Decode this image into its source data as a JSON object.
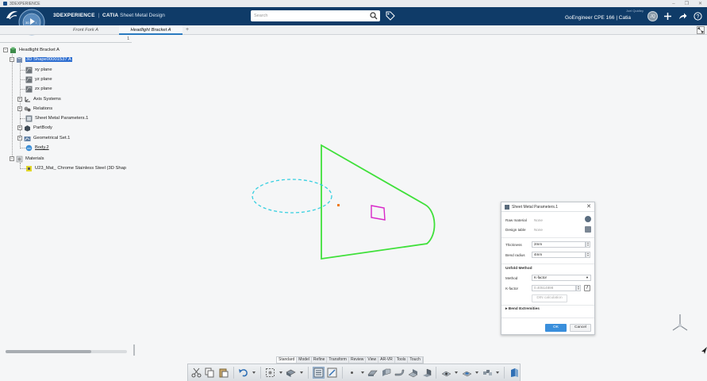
{
  "os": {
    "title": "3DEXPERIENCE"
  },
  "header": {
    "brand": "3DEXPERIENCE",
    "separator": "|",
    "app": "CATIA",
    "role": "Sheet Metal Design",
    "search_placeholder": "Search",
    "user_small": "Joel Quidley",
    "context": "GoEngineer CPE 166 | Catia",
    "avatar_initials": "JQ"
  },
  "compass": {
    "version": "V.R"
  },
  "tabs": [
    {
      "label": "Front Fork A"
    },
    {
      "label": "Headlight Bracket A"
    }
  ],
  "tab_add": "+",
  "tree": {
    "ruler_number": "1",
    "root": "Headlight Bracket A",
    "items": [
      {
        "label": "3D Shape00001537 A"
      },
      {
        "label": "xy plane"
      },
      {
        "label": "yz plane"
      },
      {
        "label": "zx plane"
      },
      {
        "label": "Axis Systems"
      },
      {
        "label": "Relations"
      },
      {
        "label": "Sheet Metal Parameters.1"
      },
      {
        "label": "PartBody"
      },
      {
        "label": "Geometrical Set.1"
      },
      {
        "label": "Body.2"
      },
      {
        "label": "Materials"
      },
      {
        "label": "U23_Mat_ Chrome Stainless Steel (3D Shap"
      }
    ]
  },
  "dialog": {
    "title": "Sheet Metal Parameters.1",
    "raw_material_label": "Raw material",
    "raw_material_value": "None",
    "design_table_label": "Design table",
    "design_table_value": "None",
    "thickness_label": "Thickness",
    "thickness_value": "2mm",
    "bend_radius_label": "Bend radius",
    "bend_radius_value": "4mm",
    "unfold_section": "Unfold Method",
    "method_label": "Method",
    "method_value": "K-factor",
    "kfactor_label": "K-factor",
    "kfactor_value": "0.40514898",
    "din_button": "DIN calculation",
    "bend_extremities": "Bend Extremities",
    "ok": "OK",
    "cancel": "Cancel"
  },
  "section_tabs": [
    "Standard",
    "Model",
    "Refine",
    "Transform",
    "Review",
    "View",
    "AR-VR",
    "Tools",
    "Touch"
  ],
  "colors": {
    "header_bg": "#0f3b68",
    "selection": "#2f6fd1",
    "profile_green": "#3fe03a",
    "circle_cyan": "#35cfe0",
    "square_magenta": "#d827c8",
    "ok_blue": "#3a8fdc"
  }
}
